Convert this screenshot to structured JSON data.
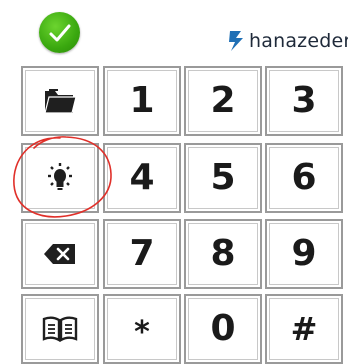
{
  "status": {
    "icon": "check-icon",
    "color": "#3aa80f"
  },
  "brand": {
    "name": "hanazeder",
    "logo_icon": "bolt-icon"
  },
  "keypad": {
    "rows": [
      [
        {
          "icon": "folder-icon"
        },
        {
          "label": "1"
        },
        {
          "label": "2"
        },
        {
          "label": "3"
        }
      ],
      [
        {
          "icon": "lightbulb-icon"
        },
        {
          "label": "4"
        },
        {
          "label": "5"
        },
        {
          "label": "6"
        }
      ],
      [
        {
          "icon": "backspace-icon"
        },
        {
          "label": "7"
        },
        {
          "label": "8"
        },
        {
          "label": "9"
        }
      ],
      [
        {
          "icon": "book-icon"
        },
        {
          "label": "*"
        },
        {
          "label": "0"
        },
        {
          "label": "#"
        }
      ]
    ]
  },
  "annotation": {
    "shape": "red-circle",
    "color": "#e0302a",
    "target": "lightbulb-icon"
  }
}
